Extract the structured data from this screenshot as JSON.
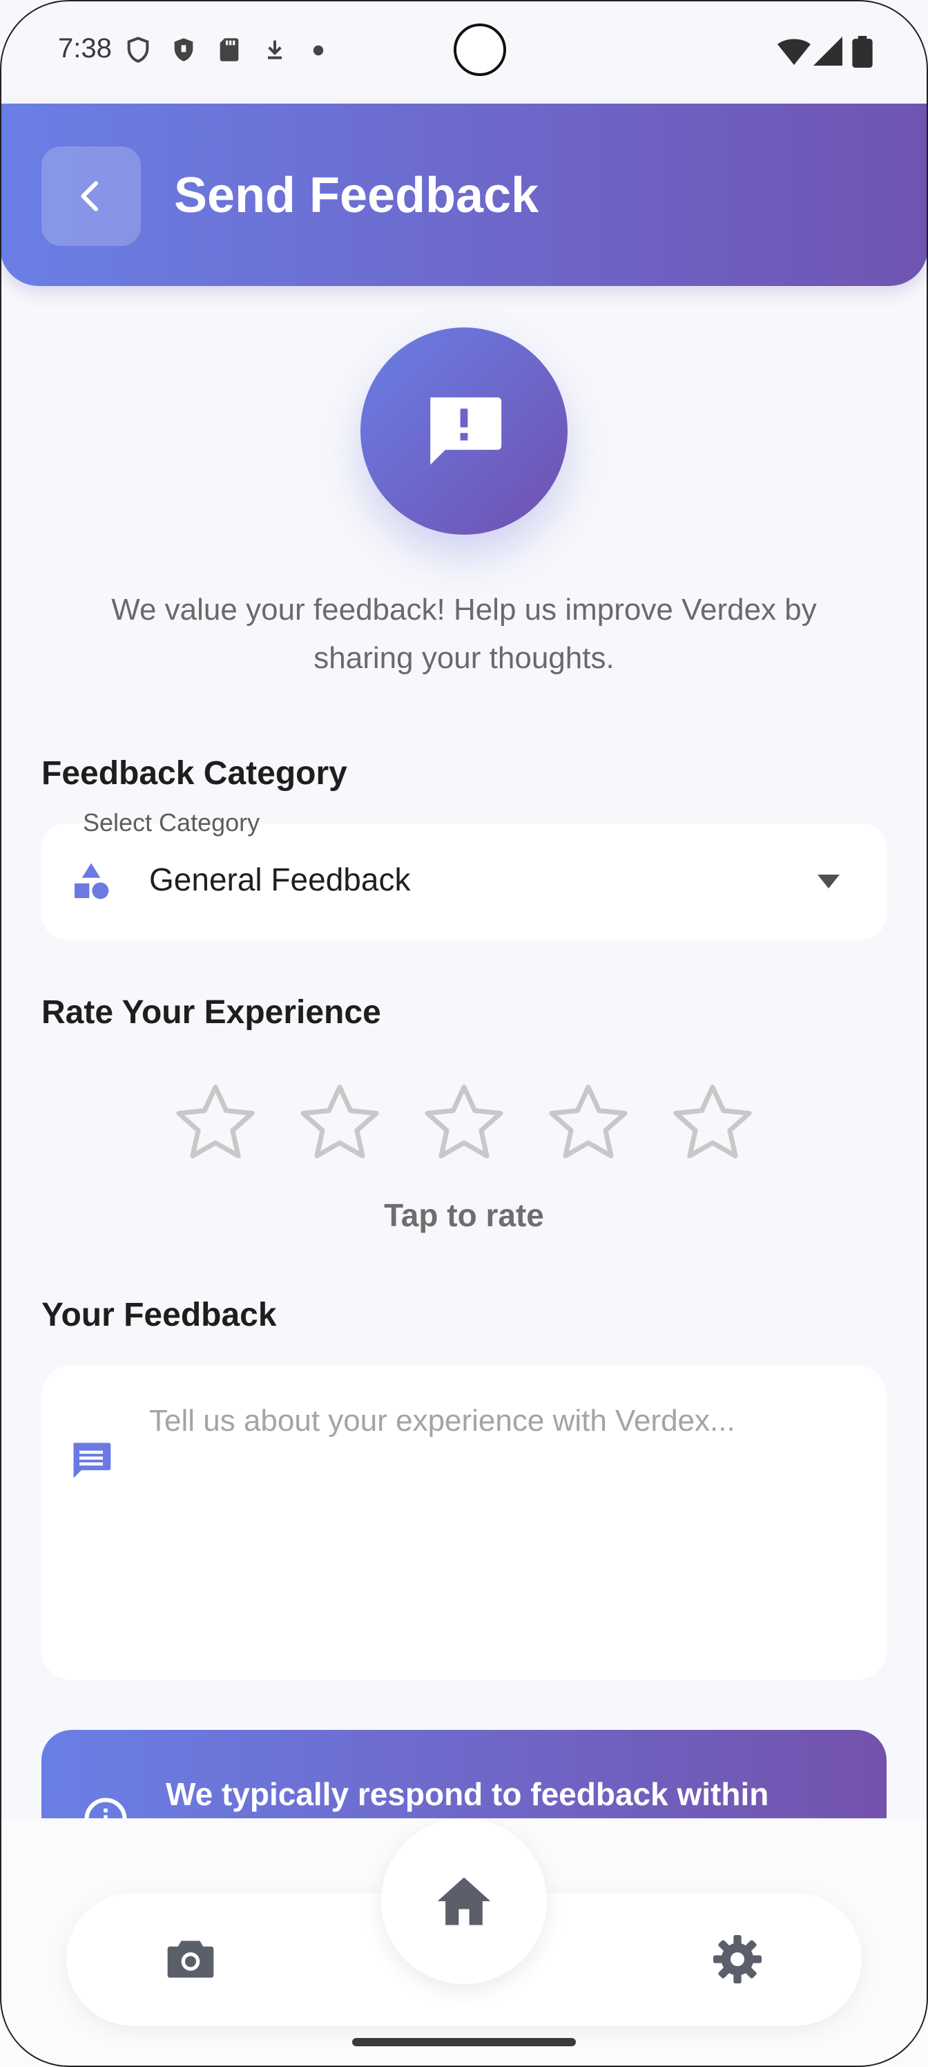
{
  "status_bar": {
    "time": "7:38"
  },
  "header": {
    "title": "Send Feedback"
  },
  "intro": {
    "line1": "We value your feedback! Help us improve Verdex by",
    "line2": "sharing your thoughts."
  },
  "category": {
    "section_label": "Feedback Category",
    "floating_label": "Select Category",
    "selected_value": "General Feedback"
  },
  "rating": {
    "section_label": "Rate Your Experience",
    "stars_total": 5,
    "stars_filled": 0,
    "hint": "Tap to rate"
  },
  "feedback": {
    "section_label": "Your Feedback",
    "placeholder": "Tell us about your experience with Verdex..."
  },
  "info_card": {
    "text": "We typically respond to feedback within"
  },
  "colors": {
    "accent_start": "#6a7fe6",
    "accent_end": "#7054b2",
    "star_empty": "#c8c8c8",
    "icon_accent": "#6b79e3"
  }
}
